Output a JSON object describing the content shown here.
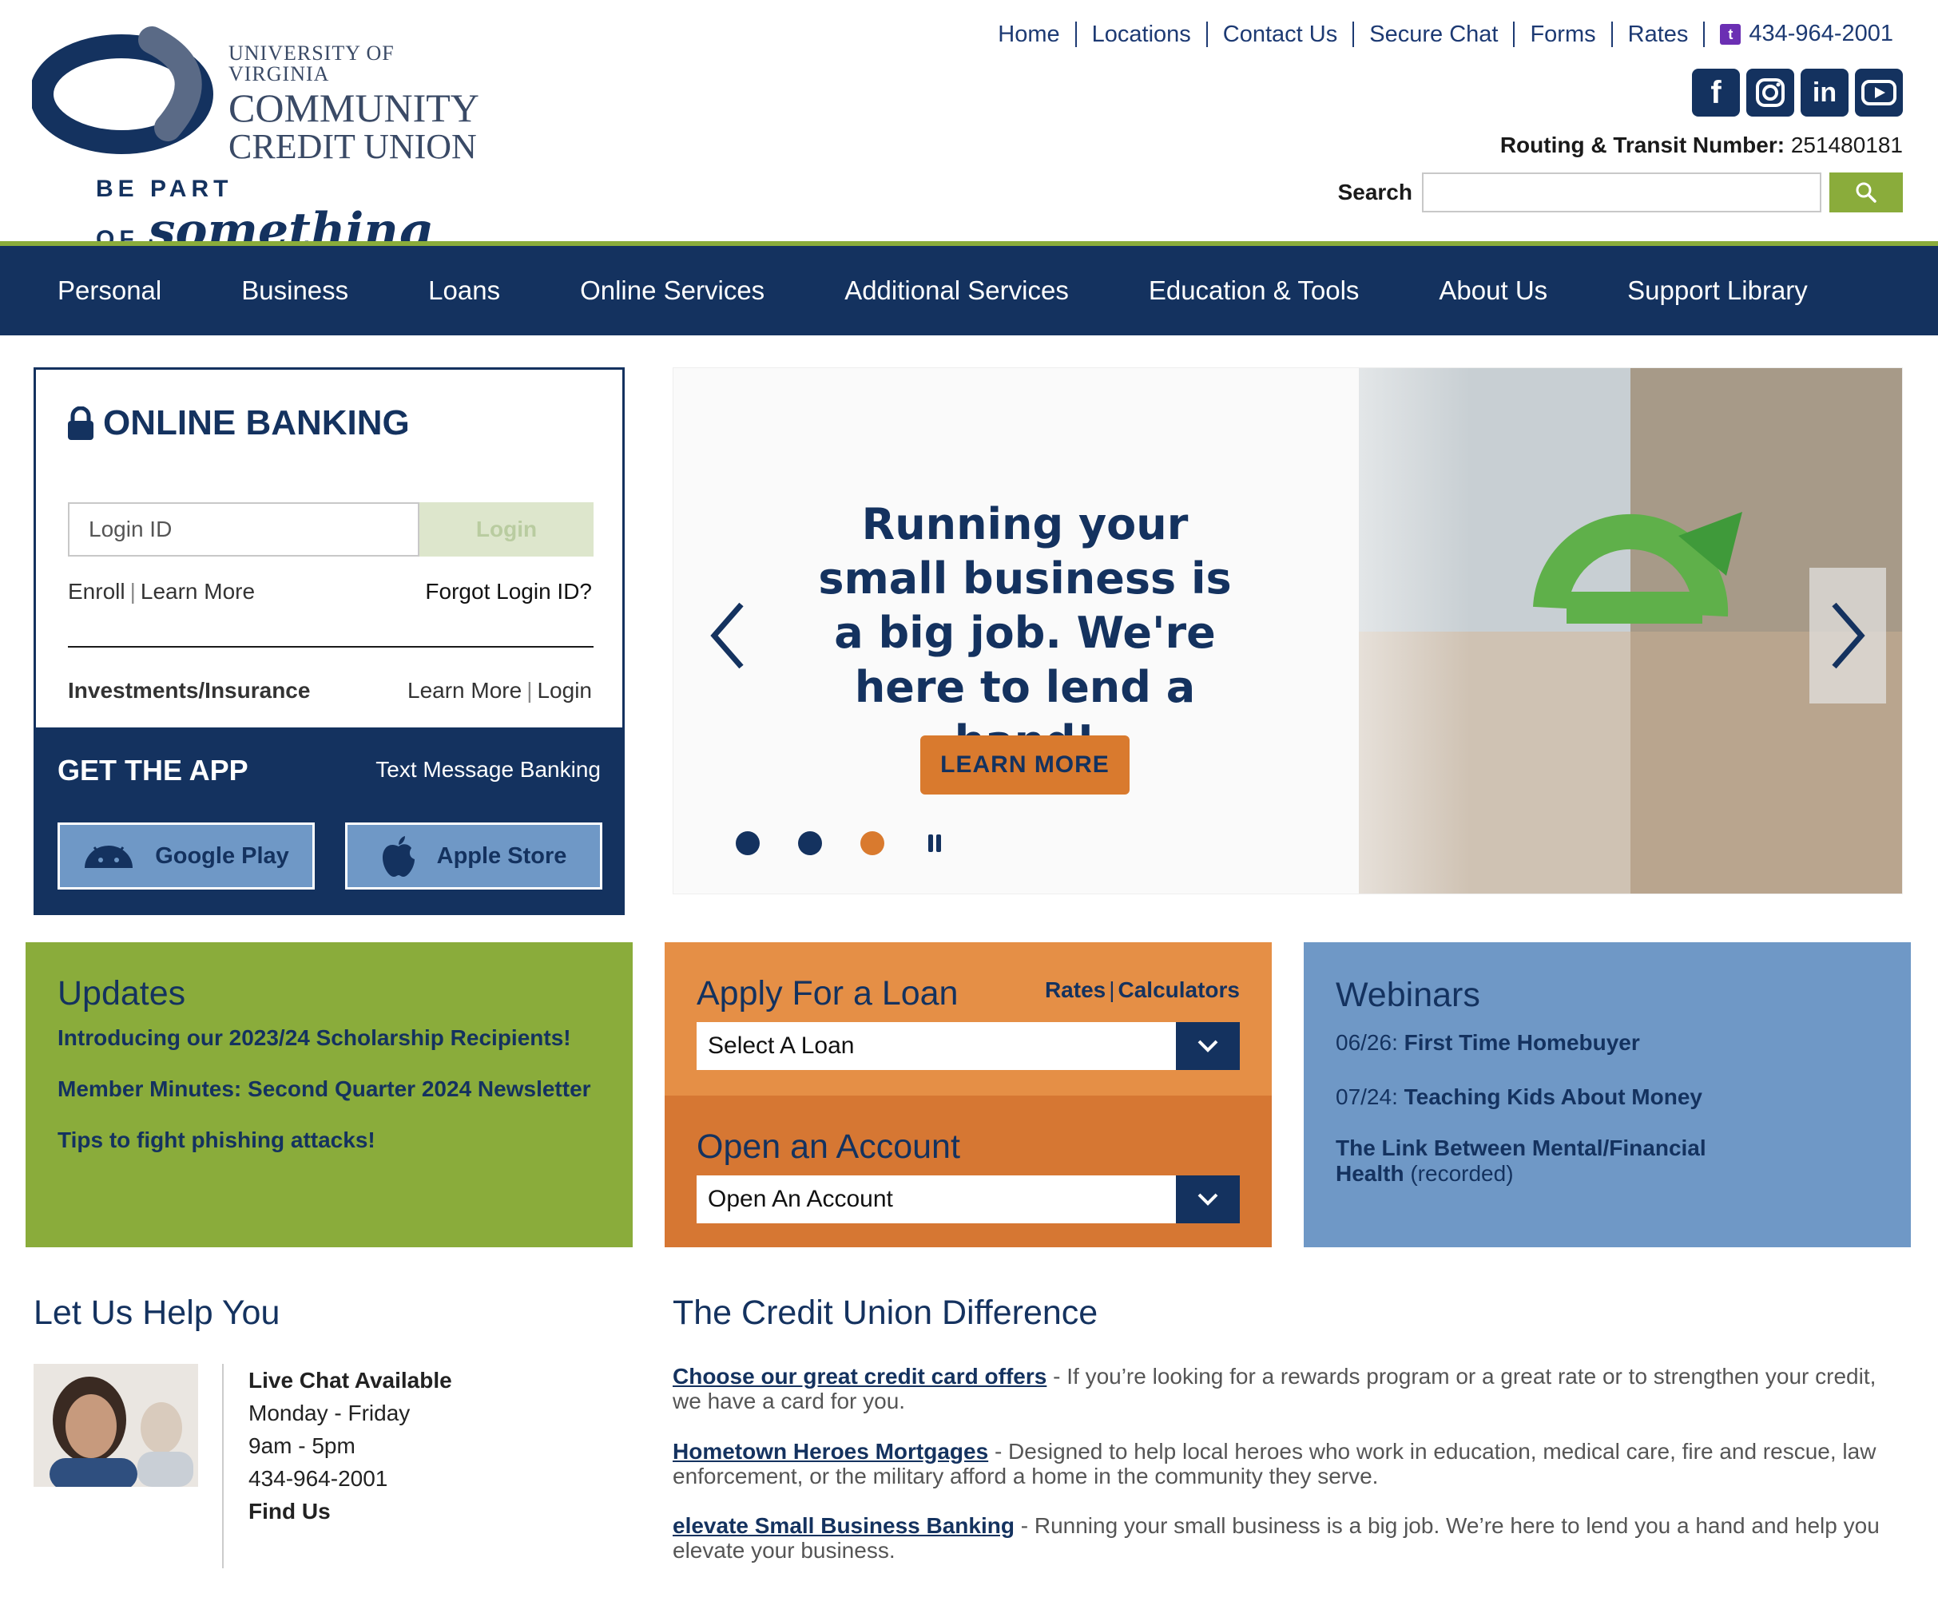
{
  "logo": {
    "line1": "UNIVERSITY OF VIRGINIA",
    "line2": "COMMUNITY",
    "line3": "CREDIT UNION",
    "tagline": "BE PART OF",
    "tagline_script": "something"
  },
  "topnav": {
    "links": [
      "Home",
      "Locations",
      "Contact Us",
      "Secure Chat",
      "Forms",
      "Rates"
    ],
    "phone": "434-964-2001"
  },
  "social": [
    "facebook-icon",
    "instagram-icon",
    "linkedin-icon",
    "youtube-icon"
  ],
  "routing": {
    "label": "Routing & Transit Number:",
    "value": "251480181"
  },
  "search": {
    "label": "Search",
    "placeholder": ""
  },
  "mainnav": [
    "Personal",
    "Business",
    "Loans",
    "Online Services",
    "Additional Services",
    "Education & Tools",
    "About Us",
    "Support Library"
  ],
  "online_banking": {
    "title": "ONLINE BANKING",
    "login_placeholder": "Login ID",
    "login_button": "Login",
    "enroll": "Enroll",
    "learn_more": "Learn More",
    "forgot": "Forgot Login ID?",
    "investments": "Investments/Insurance",
    "inv_learn_more": "Learn More",
    "inv_login": "Login"
  },
  "app": {
    "title": "GET THE APP",
    "text_banking": "Text Message Banking",
    "google": "Google Play",
    "apple": "Apple Store"
  },
  "hero": {
    "headline": "Running your small business is a big job. We're here to lend a hand!",
    "button": "LEARN MORE",
    "slide_count": 3,
    "active_slide": 3
  },
  "updates": {
    "title": "Updates",
    "items": [
      "Introducing our 2023/24 Scholarship Recipients!",
      "Member Minutes: Second Quarter 2024 Newsletter",
      "Tips to fight phishing attacks!"
    ]
  },
  "loan": {
    "title": "Apply For a Loan",
    "rates": "Rates",
    "calculators": "Calculators",
    "select_value": "Select A Loan",
    "account_title": "Open an Account",
    "account_value": "Open An Account"
  },
  "webinars": {
    "title": "Webinars",
    "items": [
      {
        "date": "06/26:",
        "name": "First Time Homebuyer",
        "note": ""
      },
      {
        "date": "07/24:",
        "name": "Teaching Kids About Money",
        "note": ""
      },
      {
        "date": "",
        "name": "The Link Between Mental/Financial Health",
        "note": "(recorded)"
      }
    ]
  },
  "help": {
    "title": "Let Us Help You",
    "lines": [
      "Live Chat Available",
      "Monday - Friday",
      "9am - 5pm",
      "434-964-2001",
      "Find Us"
    ]
  },
  "difference": {
    "title": "The Credit Union Difference",
    "items": [
      {
        "link": "Choose our great credit card offers",
        "text": " - If you’re looking for a rewards program or a great rate or to strengthen your credit, we have a card for you."
      },
      {
        "link": "Hometown Heroes Mortgages",
        "text": " - Designed to help local heroes who work in education, medical care, fire and rescue, law enforcement, or the military afford a home in the community they serve."
      },
      {
        "link": "elevate Small Business Banking",
        "text": " - Running your small business is a big job. We’re here to lend you a hand and help you elevate your business."
      }
    ]
  },
  "colors": {
    "navy": "#14325f",
    "green": "#8aac3b",
    "orange": "#d97a2e",
    "blue": "#6f98c6"
  }
}
